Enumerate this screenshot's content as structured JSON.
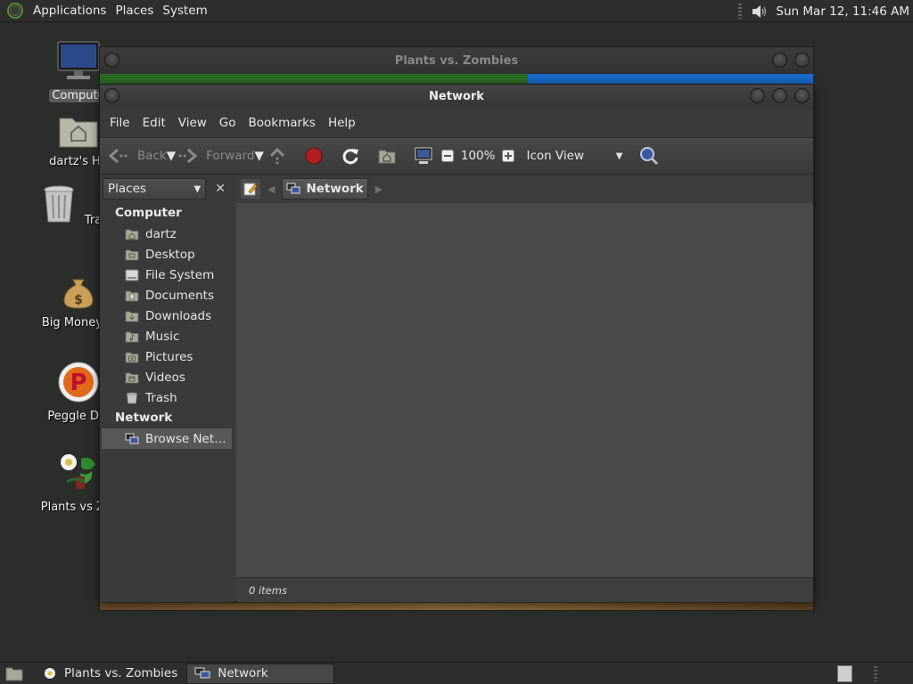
{
  "top_panel": {
    "menus": [
      "Applications",
      "Places",
      "System"
    ],
    "clock": "Sun Mar 12, 11:46 AM",
    "volume_icon": "speaker-icon"
  },
  "desktop": {
    "icons": [
      {
        "label": "Compute",
        "icon": "computer-icon",
        "selected": true
      },
      {
        "label": "dartz's Ho",
        "icon": "home-folder-icon"
      },
      {
        "label": "Trash",
        "icon": "trash-icon"
      },
      {
        "label": "Big Money D",
        "icon": "money-bag-icon"
      },
      {
        "label": "Peggle Del",
        "icon": "peggle-icon"
      },
      {
        "label": "Plants vs Zor",
        "icon": "plants-vs-zombies-icon"
      }
    ]
  },
  "pvz_window": {
    "title": "Plants vs. Zombies"
  },
  "network_window": {
    "title": "Network",
    "menu": [
      "File",
      "Edit",
      "View",
      "Go",
      "Bookmarks",
      "Help"
    ],
    "toolbar": {
      "back": "Back",
      "forward": "Forward",
      "zoom": "100%",
      "view_mode": "Icon View"
    },
    "sidebar": {
      "combo_label": "Places",
      "sections": [
        {
          "header": "Computer",
          "items": [
            {
              "label": "dartz",
              "icon": "home-folder-icon"
            },
            {
              "label": "Desktop",
              "icon": "desktop-folder-icon"
            },
            {
              "label": "File System",
              "icon": "drive-icon"
            },
            {
              "label": "Documents",
              "icon": "documents-folder-icon"
            },
            {
              "label": "Downloads",
              "icon": "downloads-folder-icon"
            },
            {
              "label": "Music",
              "icon": "music-folder-icon"
            },
            {
              "label": "Pictures",
              "icon": "pictures-folder-icon"
            },
            {
              "label": "Videos",
              "icon": "videos-folder-icon"
            },
            {
              "label": "Trash",
              "icon": "trash-icon"
            }
          ]
        },
        {
          "header": "Network",
          "items": [
            {
              "label": "Browse Net…",
              "icon": "network-icon",
              "active": true
            }
          ]
        }
      ]
    },
    "path": {
      "current": "Network"
    },
    "status": "0 items"
  },
  "bottom_panel": {
    "tasks": [
      {
        "label": "Plants vs. Zombies",
        "icon": "plants-vs-zombies-icon",
        "active": false
      },
      {
        "label": "Network",
        "icon": "network-icon",
        "active": true
      }
    ]
  }
}
